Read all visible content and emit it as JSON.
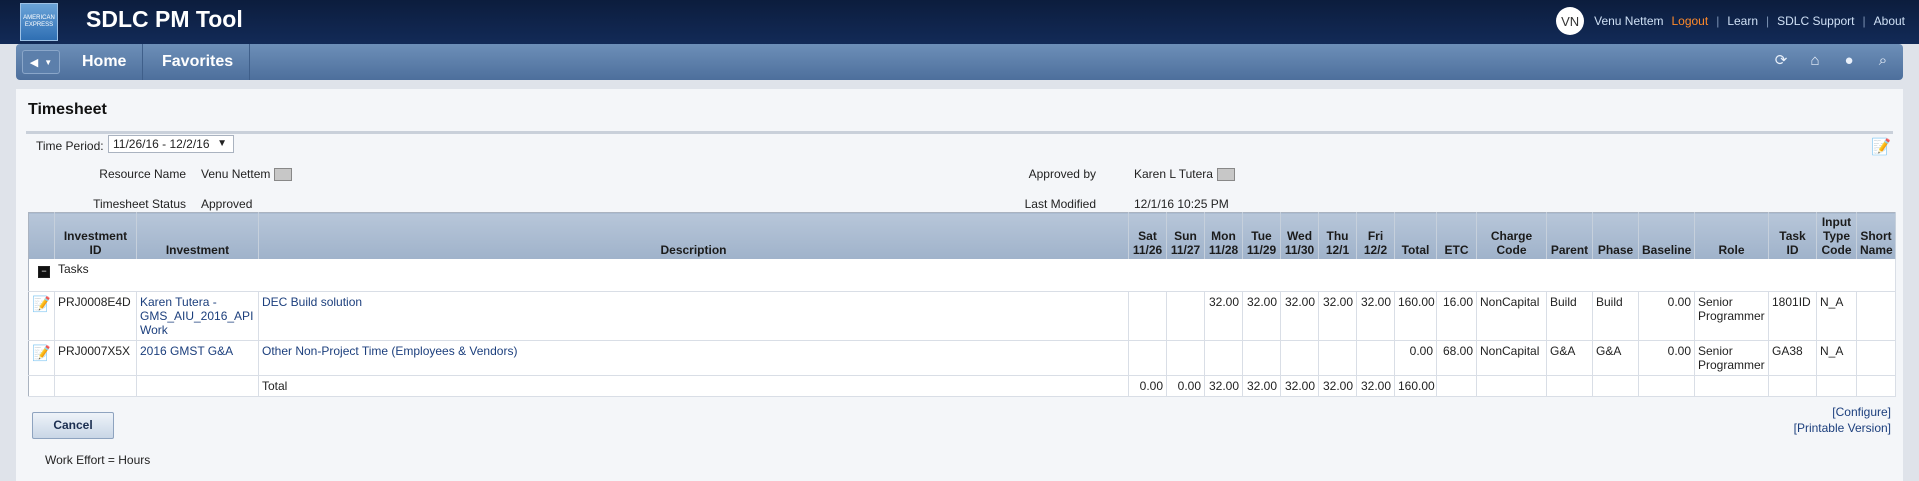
{
  "header": {
    "app_title": "SDLC PM Tool",
    "logo_text": "AMERICAN EXPRESS",
    "avatar_initials": "VN",
    "user_name": "Venu Nettem",
    "links": {
      "logout": "Logout",
      "learn": "Learn",
      "support": "SDLC Support",
      "about": "About"
    }
  },
  "nav": {
    "back_icon": "back-arrow-icon",
    "items": [
      "Home",
      "Favorites"
    ],
    "right_icons": [
      "refresh-icon",
      "home-icon",
      "help-icon",
      "search-icon"
    ]
  },
  "page": {
    "title": "Timesheet",
    "time_period_label": "Time Period:",
    "time_period_value": "11/26/16 - 12/2/16",
    "resource_name_label": "Resource Name",
    "resource_name": "Venu Nettem",
    "timesheet_status_label": "Timesheet Status",
    "timesheet_status": "Approved",
    "approved_by_label": "Approved by",
    "approved_by": "Karen L Tutera",
    "last_modified_label": "Last Modified",
    "last_modified": "12/1/16 10:25 PM"
  },
  "table": {
    "columns": {
      "investment_id": "Investment ID",
      "investment": "Investment",
      "description": "Description",
      "sat": "Sat 11/26",
      "sun": "Sun 11/27",
      "mon": "Mon 11/28",
      "tue": "Tue 11/29",
      "wed": "Wed 11/30",
      "thu": "Thu 12/1",
      "fri": "Fri 12/2",
      "total": "Total",
      "etc": "ETC",
      "charge_code": "Charge Code",
      "parent": "Parent",
      "phase": "Phase",
      "baseline": "Baseline",
      "role": "Role",
      "task_id": "Task ID",
      "input_type_code": "Input Type Code",
      "short_name": "Short Name"
    },
    "group_label": "Tasks",
    "rows": [
      {
        "investment_id": "PRJ0008E4D",
        "investment": "Karen Tutera - GMS_AIU_2016_API Work",
        "description": "DEC Build solution",
        "sat": "",
        "sun": "",
        "mon": "32.00",
        "tue": "32.00",
        "wed": "32.00",
        "thu": "32.00",
        "fri": "32.00",
        "total": "160.00",
        "etc": "16.00",
        "charge_code": "NonCapital",
        "parent": "Build",
        "phase": "Build",
        "baseline": "0.00",
        "role": "Senior Programmer",
        "task_id": "1801ID",
        "input_type_code": "N_A",
        "short_name": ""
      },
      {
        "investment_id": "PRJ0007X5X",
        "investment": "2016 GMST G&A",
        "description": "Other Non-Project Time (Employees & Vendors)",
        "sat": "",
        "sun": "",
        "mon": "",
        "tue": "",
        "wed": "",
        "thu": "",
        "fri": "",
        "total": "0.00",
        "etc": "68.00",
        "charge_code": "NonCapital",
        "parent": "G&A",
        "phase": "G&A",
        "baseline": "0.00",
        "role": "Senior Programmer",
        "task_id": "GA38",
        "input_type_code": "N_A",
        "short_name": ""
      }
    ],
    "totals": {
      "label": "Total",
      "sat": "0.00",
      "sun": "0.00",
      "mon": "32.00",
      "tue": "32.00",
      "wed": "32.00",
      "thu": "32.00",
      "fri": "32.00",
      "total": "160.00"
    }
  },
  "actions": {
    "configure": "[Configure]",
    "printable": "[Printable Version]",
    "cancel": "Cancel"
  },
  "footnote": "Work Effort = Hours"
}
